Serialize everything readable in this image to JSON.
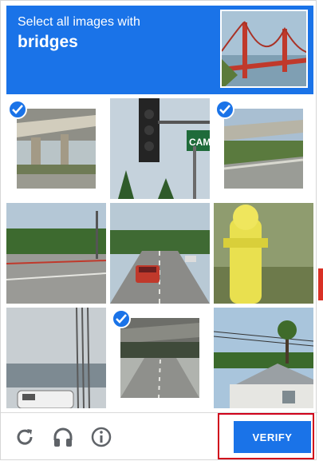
{
  "header": {
    "instruction_line1": "Select all images with",
    "instruction_target": "bridges"
  },
  "tiles": [
    {
      "name": "tile-1",
      "subject": "highway overpass",
      "selected": true
    },
    {
      "name": "tile-2",
      "subject": "traffic light and street sign",
      "selected": false,
      "sign_text": "CAMI"
    },
    {
      "name": "tile-3",
      "subject": "highway bridge",
      "selected": true
    },
    {
      "name": "tile-4",
      "subject": "road intersection",
      "selected": false
    },
    {
      "name": "tile-5",
      "subject": "street with red car",
      "selected": false
    },
    {
      "name": "tile-6",
      "subject": "yellow fire hydrant",
      "selected": false
    },
    {
      "name": "tile-7",
      "subject": "wires and van",
      "selected": false
    },
    {
      "name": "tile-8",
      "subject": "road under bridge",
      "selected": true
    },
    {
      "name": "tile-9",
      "subject": "house with palm trees",
      "selected": false
    }
  ],
  "footer": {
    "reload_icon": "reload-icon",
    "audio_icon": "headphones-icon",
    "info_icon": "info-icon",
    "verify_label": "VERIFY"
  },
  "colors": {
    "accent": "#1a73e8",
    "highlight_outline": "#d0021b"
  }
}
